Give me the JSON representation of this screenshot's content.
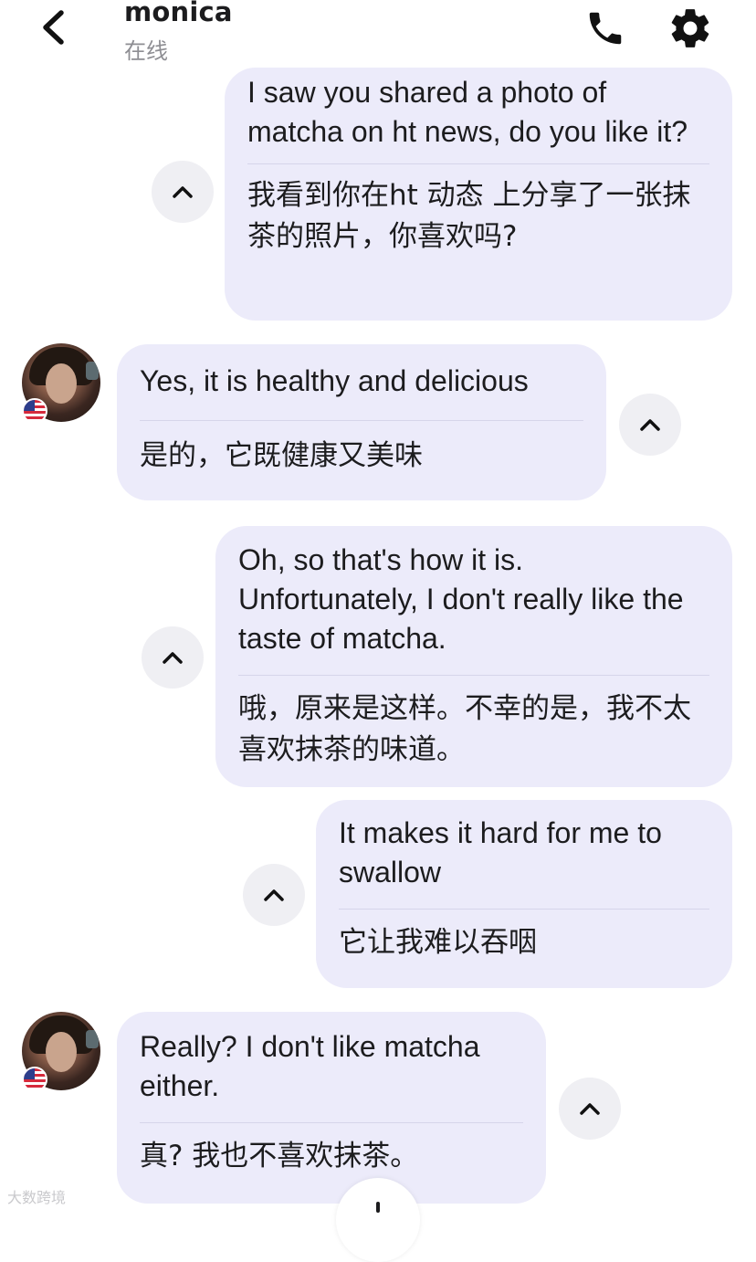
{
  "header": {
    "contact_name": "monica",
    "status": "在线",
    "back_icon": "chevron-left-icon",
    "call_icon": "phone-icon",
    "settings_icon": "gear-icon"
  },
  "messages": [
    {
      "sender": "me",
      "en": "I saw you shared a photo of matcha on ht news, do you like it?",
      "zh": "我看到你在ht  动态 上分享了一张抹茶的照片，你喜欢吗?"
    },
    {
      "sender": "monica",
      "en": "Yes, it is healthy and delicious",
      "zh": "是的，它既健康又美味"
    },
    {
      "sender": "me",
      "en": "Oh, so that's how it is. Unfortunately, I don't really like the taste of matcha.",
      "zh": "哦，原来是这样。不幸的是，我不太喜欢抹茶的味道。"
    },
    {
      "sender": "me",
      "en": "It makes it hard for me to swallow",
      "zh": "它让我难以吞咽"
    },
    {
      "sender": "monica",
      "en": "Really? I don't like matcha either.",
      "zh": "真? 我也不喜欢抹茶。"
    }
  ],
  "watermark": "大数跨境",
  "colors": {
    "bubble": "#ecebfa",
    "fold_button": "#efeff3",
    "status_text": "#8e8e93"
  }
}
